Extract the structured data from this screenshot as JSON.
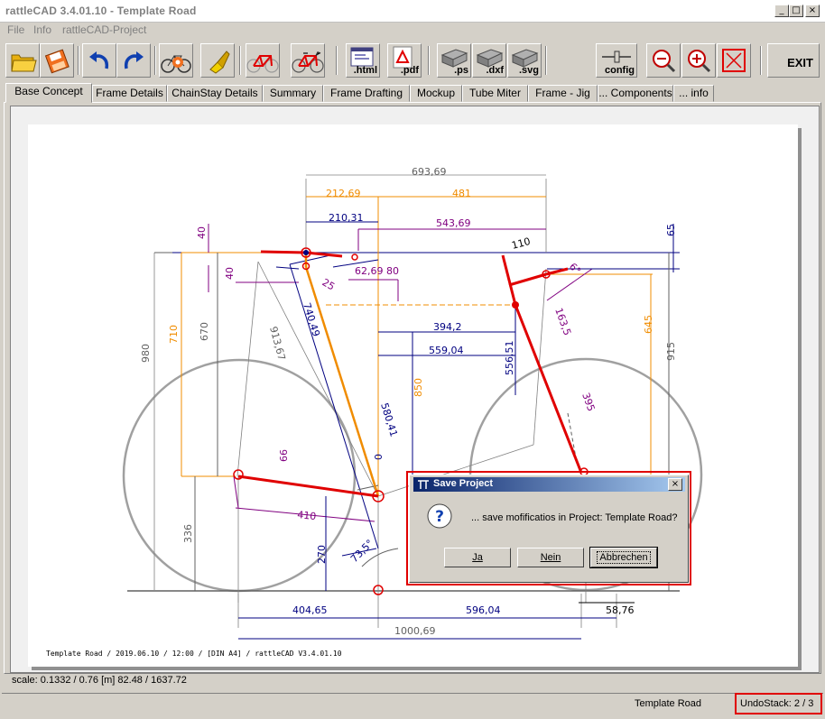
{
  "window": {
    "title": "rattleCAD  3.4.01.10 - Template Road",
    "controls": {
      "minimize": "_",
      "maximize": "□",
      "close": "×"
    }
  },
  "menu": [
    "File",
    "Info",
    "rattleCAD-Project"
  ],
  "toolbar": {
    "buttons": [
      {
        "icon": "open-folder-icon"
      },
      {
        "icon": "save-disk-icon"
      },
      {
        "icon": "undo-icon"
      },
      {
        "icon": "redo-icon"
      },
      {
        "icon": "bike-settings-icon"
      },
      {
        "icon": "paint-brush-icon"
      },
      {
        "icon": "red-frame-icon"
      },
      {
        "icon": "red-bike-icon"
      },
      {
        "icon": "export-html-icon",
        "label": ".html"
      },
      {
        "icon": "export-pdf-icon",
        "label": ".pdf"
      },
      {
        "icon": "export-ps-icon",
        "label": ".ps"
      },
      {
        "icon": "export-dxf-icon",
        "label": ".dxf"
      },
      {
        "icon": "export-svg-icon",
        "label": ".svg"
      },
      {
        "icon": "config-icon",
        "label": "config"
      },
      {
        "icon": "zoom-out-icon"
      },
      {
        "icon": "zoom-in-icon"
      },
      {
        "icon": "fit-view-icon"
      }
    ],
    "exit_label": "EXIT"
  },
  "tabs": [
    {
      "label": "Base Concept",
      "active": true
    },
    {
      "label": "Frame Details"
    },
    {
      "label": "ChainStay Details"
    },
    {
      "label": "Summary"
    },
    {
      "label": "Frame Drafting"
    },
    {
      "label": "Mockup"
    },
    {
      "label": "Tube Miter"
    },
    {
      "label": "Frame - Jig"
    },
    {
      "label": "... Components"
    },
    {
      "label": "... info"
    }
  ],
  "drawing": {
    "dimensions": {
      "d693": "693,69",
      "d212": "212,69",
      "d481": "481",
      "d210": "210,31",
      "d543": "543,69",
      "d40a": "40",
      "d40b": "40",
      "d65": "65",
      "d110": "110",
      "d62": "62,69",
      "d80": "80",
      "d25": "25",
      "d710": "710",
      "d670": "670",
      "d980": "980",
      "d740": "740,49",
      "d913": "913,67",
      "d394": "394,2",
      "d559": "559,04",
      "d556": "556,51",
      "d850": "850",
      "d580": "580,41",
      "d163": "163,5",
      "d645": "645",
      "d915": "915",
      "d395": "395",
      "d66": "66",
      "d0": "0",
      "d410": "410",
      "d336": "336",
      "d270": "270",
      "d735": "73,5°",
      "d404": "404,65",
      "d596": "596,04",
      "d58": "58,76",
      "d1000": "1000,69",
      "d6": "6°"
    },
    "footnote": "Template Road   /   2019.06.10 / 12:00   /   [DIN A4]   /   rattleCAD   V3.4.01.10"
  },
  "scale_text": "scale: 0.1332 / 0.76  [m]  82.48 / 1637.72",
  "status": {
    "project": "Template Road",
    "undo": "UndoStack:  2 / 3"
  },
  "dialog": {
    "title": "Save Project",
    "close": "×",
    "message": "... save mofificatios in Project:  Template Road?",
    "buttons": {
      "yes": "Ja",
      "no": "Nein",
      "cancel": "Abbrechen"
    }
  },
  "colors": {
    "frame": "#e00000",
    "fork": "#f08c00",
    "dim_orange": "#f08c00",
    "dim_purple": "#800080",
    "dim_navy": "#000080",
    "dim_gray": "#606060",
    "wheel": "#a0a0a0"
  }
}
